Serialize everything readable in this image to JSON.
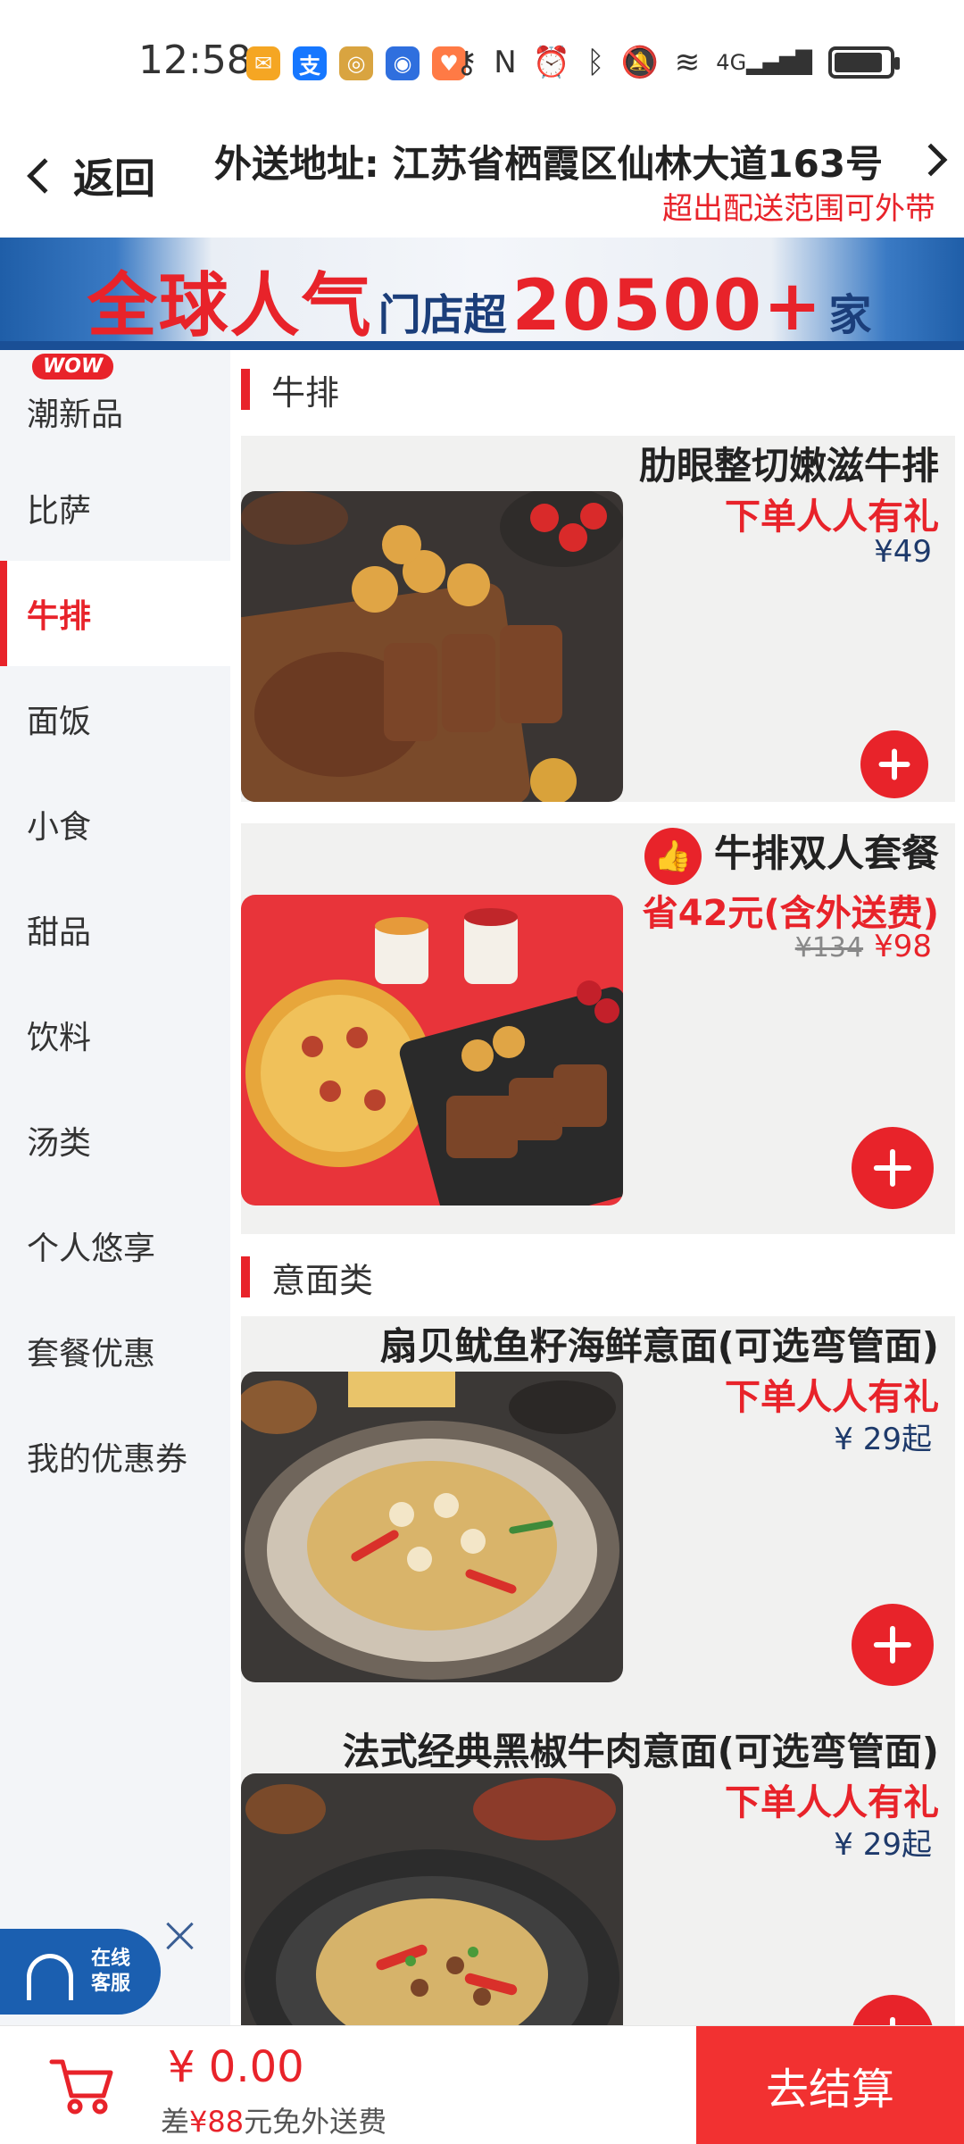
{
  "status_bar": {
    "time": "12:58",
    "app_icons": [
      "mail-icon",
      "alipay-icon",
      "app-icon",
      "browser-icon",
      "health-icon"
    ],
    "network": "4G"
  },
  "header": {
    "back_label": "返回",
    "address": "外送地址: 江苏省栖霞区仙林大道163号",
    "address_note": "超出配送范围可外带"
  },
  "banner": {
    "part1": "全球人气",
    "part2": "门店超",
    "part3": "20500+",
    "part4": "家"
  },
  "sidebar": {
    "new_badge": "WOW",
    "items": [
      {
        "label": "潮新品"
      },
      {
        "label": "比萨"
      },
      {
        "label": "牛排"
      },
      {
        "label": "面饭"
      },
      {
        "label": "小食"
      },
      {
        "label": "甜品"
      },
      {
        "label": "饮料"
      },
      {
        "label": "汤类"
      },
      {
        "label": "个人悠享"
      },
      {
        "label": "套餐优惠"
      },
      {
        "label": "我的优惠券"
      }
    ],
    "active_index": 2
  },
  "sections": [
    {
      "title": "牛排",
      "products": [
        {
          "name": "肋眼整切嫩滋牛排",
          "promo": "下单人人有礼",
          "price": "¥49"
        },
        {
          "name": "牛排双人套餐",
          "promo": "省42元(含外送费)",
          "old_price": "¥134",
          "price": "¥98"
        }
      ]
    },
    {
      "title": "意面类",
      "products": [
        {
          "name": "扇贝鱿鱼籽海鲜意面(可选弯管面)",
          "promo": "下单人人有礼",
          "price": "¥ 29起"
        },
        {
          "name": "法式经典黑椒牛肉意面(可选弯管面)",
          "promo": "下单人人有礼",
          "price": "¥ 29起"
        }
      ]
    }
  ],
  "service": {
    "line1": "在线",
    "line2": "客服"
  },
  "cart": {
    "total": "¥ 0.00",
    "free_prefix": "差",
    "free_amount": "¥88",
    "free_suffix": "元免外送费",
    "checkout_label": "去结算"
  },
  "colors": {
    "accent_red": "#e8232a",
    "banner_blue": "#1f5ea8",
    "price_navy": "#1e3a6b"
  }
}
